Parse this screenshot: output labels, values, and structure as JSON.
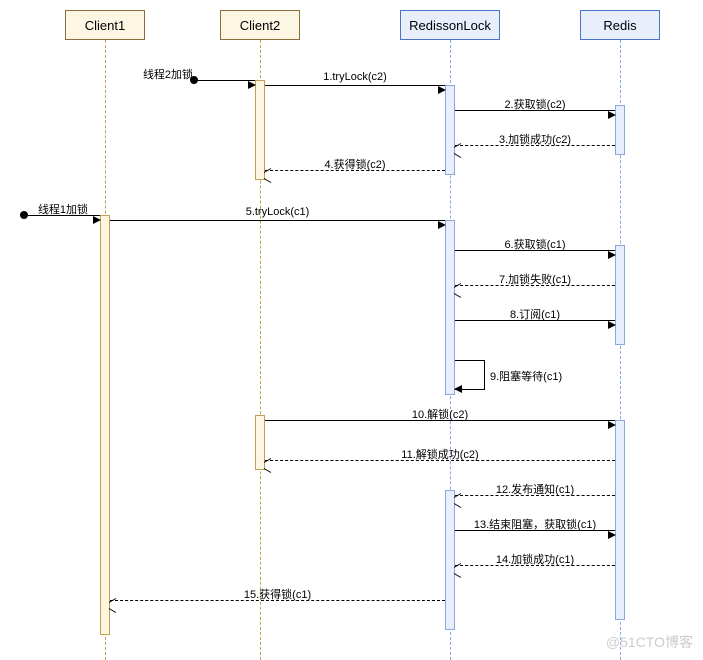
{
  "participants": {
    "client1": "Client1",
    "client2": "Client2",
    "redissonLock": "RedissonLock",
    "redis": "Redis"
  },
  "found": {
    "thread2lock": "线程2加锁",
    "thread1lock": "线程1加锁"
  },
  "messages": {
    "m1": "1.tryLock(c2)",
    "m2": "2.获取锁(c2)",
    "m3": "3.加锁成功(c2)",
    "m4": "4.获得锁(c2)",
    "m5": "5.tryLock(c1)",
    "m6": "6.获取锁(c1)",
    "m7": "7.加锁失败(c1)",
    "m8": "8.订阅(c1)",
    "m9": "9.阻塞等待(c1)",
    "m10": "10.解锁(c2)",
    "m11": "11.解锁成功(c2)",
    "m12": "12.发布通知(c1)",
    "m13": "13.结束阻塞，获取锁(c1)",
    "m14": "14.加锁成功(c1)",
    "m15": "15.获得锁(c1)"
  },
  "watermark": "@51CTO博客",
  "chart_data": {
    "type": "table",
    "title": "UML Sequence Diagram: Redisson distributed lock acquisition with two clients",
    "participants": [
      "Client1",
      "Client2",
      "RedissonLock",
      "Redis"
    ],
    "messages": [
      {
        "n": 0,
        "from": "external",
        "to": "Client2",
        "label": "线程2加锁",
        "style": "found"
      },
      {
        "n": 1,
        "from": "Client2",
        "to": "RedissonLock",
        "label": "1.tryLock(c2)",
        "style": "sync"
      },
      {
        "n": 2,
        "from": "RedissonLock",
        "to": "Redis",
        "label": "2.获取锁(c2)",
        "style": "sync"
      },
      {
        "n": 3,
        "from": "Redis",
        "to": "RedissonLock",
        "label": "3.加锁成功(c2)",
        "style": "return"
      },
      {
        "n": 4,
        "from": "RedissonLock",
        "to": "Client2",
        "label": "4.获得锁(c2)",
        "style": "return"
      },
      {
        "n": 0,
        "from": "external",
        "to": "Client1",
        "label": "线程1加锁",
        "style": "found"
      },
      {
        "n": 5,
        "from": "Client1",
        "to": "RedissonLock",
        "label": "5.tryLock(c1)",
        "style": "sync"
      },
      {
        "n": 6,
        "from": "RedissonLock",
        "to": "Redis",
        "label": "6.获取锁(c1)",
        "style": "sync"
      },
      {
        "n": 7,
        "from": "Redis",
        "to": "RedissonLock",
        "label": "7.加锁失败(c1)",
        "style": "return"
      },
      {
        "n": 8,
        "from": "RedissonLock",
        "to": "Redis",
        "label": "8.订阅(c1)",
        "style": "sync"
      },
      {
        "n": 9,
        "from": "RedissonLock",
        "to": "RedissonLock",
        "label": "9.阻塞等待(c1)",
        "style": "self"
      },
      {
        "n": 10,
        "from": "Client2",
        "to": "Redis",
        "label": "10.解锁(c2)",
        "style": "sync"
      },
      {
        "n": 11,
        "from": "Redis",
        "to": "Client2",
        "label": "11.解锁成功(c2)",
        "style": "return"
      },
      {
        "n": 12,
        "from": "Redis",
        "to": "RedissonLock",
        "label": "12.发布通知(c1)",
        "style": "return"
      },
      {
        "n": 13,
        "from": "RedissonLock",
        "to": "Redis",
        "label": "13.结束阻塞，获取锁(c1)",
        "style": "sync"
      },
      {
        "n": 14,
        "from": "Redis",
        "to": "RedissonLock",
        "label": "14.加锁成功(c1)",
        "style": "return"
      },
      {
        "n": 15,
        "from": "RedissonLock",
        "to": "Client1",
        "label": "15.获得锁(c1)",
        "style": "return"
      }
    ]
  }
}
